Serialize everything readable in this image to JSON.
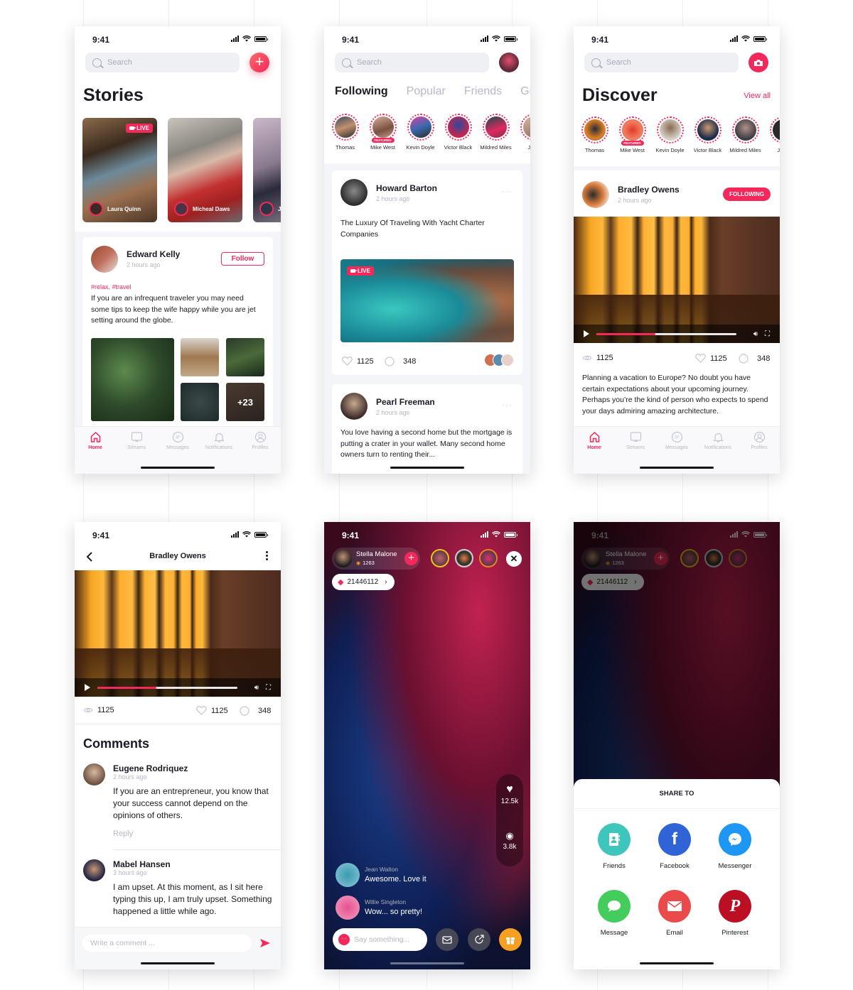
{
  "status_time": "9:41",
  "colors": {
    "accent": "#f4285a",
    "text": "#1b1b24",
    "muted": "#b5b9c4",
    "search_bg": "#eef0f4"
  },
  "search_placeholder": "Search",
  "tabbar": {
    "items": [
      {
        "label": "Home",
        "icon": "home-icon",
        "active": true
      },
      {
        "label": "Streams",
        "icon": "streams-icon",
        "active": false
      },
      {
        "label": "Messages",
        "icon": "messages-icon",
        "active": false
      },
      {
        "label": "Notifications",
        "icon": "bell-icon",
        "active": false
      },
      {
        "label": "Profiles",
        "icon": "profile-icon",
        "active": false
      }
    ]
  },
  "screen1": {
    "title": "Stories",
    "add_icon": "plus-icon",
    "stories": [
      {
        "name": "Laura Quinn",
        "live": true,
        "live_label": "LIVE"
      },
      {
        "name": "Micheal Daws",
        "live": false
      },
      {
        "name": "J",
        "live": false
      }
    ],
    "post": {
      "author": "Edward Kelly",
      "time": "2 hours ago",
      "follow_label": "Follow",
      "tags": "#relax, #travel",
      "text": "If you are an infrequent traveler you may need some tips to keep the wife happy while you are jet setting around the globe.",
      "more_photos": "+23"
    }
  },
  "screen2": {
    "tabs": [
      "Following",
      "Popular",
      "Friends",
      "Gro"
    ],
    "active_tab": "Following",
    "stories": [
      {
        "name": "Thomas",
        "featured": false
      },
      {
        "name": "Mike West",
        "featured": true
      },
      {
        "name": "Kevin Doyle",
        "featured": false
      },
      {
        "name": "Victor Black",
        "featured": false
      },
      {
        "name": "Mildred Miles",
        "featured": false
      },
      {
        "name": "Jane",
        "featured": false
      }
    ],
    "featured_label": "FEATURED",
    "posts": [
      {
        "author": "Howard Barton",
        "time": "2 hours ago",
        "text": "The Luxury Of Traveling With Yacht Charter Companies",
        "live_label": "LIVE",
        "likes": "1125",
        "comments": "348"
      },
      {
        "author": "Pearl Freeman",
        "time": "2 hours ago",
        "text": "You love having a second home but the mortgage is putting a crater in your wallet. Many second home owners turn to renting their..."
      }
    ]
  },
  "screen3": {
    "title": "Discover",
    "view_all": "View all",
    "camera_icon": "camera-icon",
    "stories": [
      {
        "name": "Thomas",
        "featured": false
      },
      {
        "name": "Mike West",
        "featured": true
      },
      {
        "name": "Kevin Doyle",
        "featured": false
      },
      {
        "name": "Victor Black",
        "featured": false
      },
      {
        "name": "Mildred Miles",
        "featured": false
      },
      {
        "name": "Jane",
        "featured": false
      }
    ],
    "featured_label": "FEATURED",
    "post": {
      "author": "Bradley Owens",
      "time": "2 hours ago",
      "following_label": "FOLLOWING",
      "video_progress": 0.42,
      "views": "1125",
      "likes": "1125",
      "comments": "348",
      "text": "Planning a vacation to Europe? No doubt you have certain expectations about your upcoming journey. Perhaps you’re the kind of person who expects to spend your days admiring amazing architecture."
    }
  },
  "screen4": {
    "header_title": "Bradley Owens",
    "video_progress": 0.42,
    "views": "1125",
    "likes": "1125",
    "comments": "348",
    "comments_title": "Comments",
    "comment_list": [
      {
        "author": "Eugene Rodriquez",
        "time": "2 hours ago",
        "text": "If you are an entrepreneur, you know that your success cannot depend on the opinions of others.",
        "reply_label": "Reply"
      },
      {
        "author": "Mabel Hansen",
        "time": "3 hours ago",
        "text": "I am upset. At this moment, as I sit here typing this up, I am truly upset. Something happened a little while ago."
      }
    ],
    "comment_placeholder": "Write a comment ..."
  },
  "screen5": {
    "host": "Stella Malone",
    "host_viewers": "1263",
    "diamonds": "21446112",
    "likes": "12.5k",
    "views": "3.8k",
    "chat": [
      {
        "author": "Jean Walton",
        "text": "Awesome. Love it"
      },
      {
        "author": "Willie Singleton",
        "text": "Wow... so pretty!"
      }
    ],
    "say_placeholder": "Say something..."
  },
  "screen6": {
    "host": "Stella Malone",
    "host_viewers": "1263",
    "diamonds": "21446112",
    "share_title": "SHARE TO",
    "share_targets": [
      {
        "label": "Friends",
        "color": "#3ec6bd",
        "icon": "contacts-icon"
      },
      {
        "label": "Facebook",
        "color": "#2f63d6",
        "icon": "facebook-icon"
      },
      {
        "label": "Messenger",
        "color": "#1e96f4",
        "icon": "messenger-icon"
      },
      {
        "label": "Message",
        "color": "#44cc5c",
        "icon": "message-icon"
      },
      {
        "label": "Email",
        "color": "#ea4a4a",
        "icon": "email-icon"
      },
      {
        "label": "Pinterest",
        "color": "#bd0f24",
        "icon": "pinterest-icon"
      }
    ]
  }
}
